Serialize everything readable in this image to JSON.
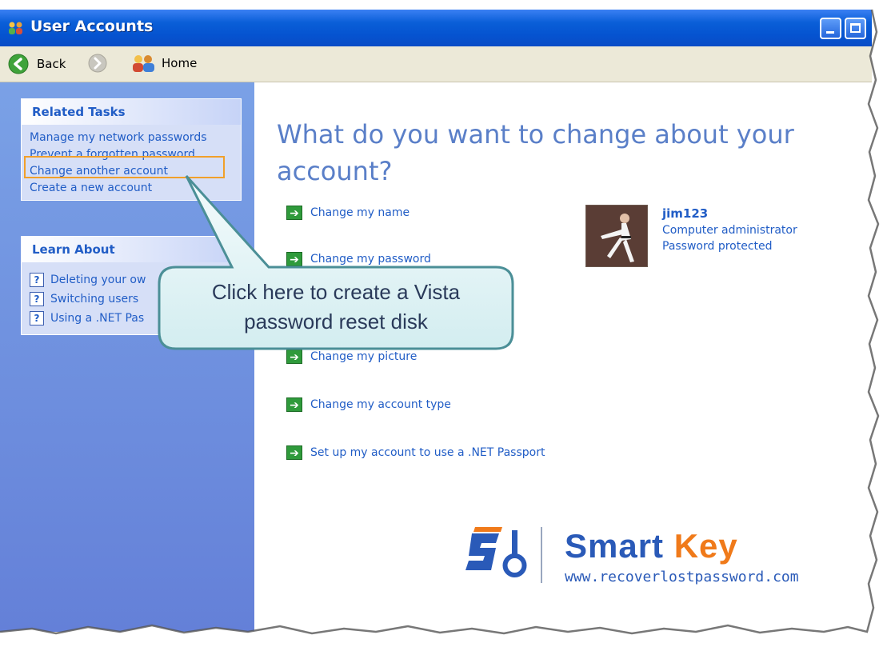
{
  "window": {
    "title": "User Accounts"
  },
  "toolbar": {
    "back_label": "Back",
    "home_label": "Home"
  },
  "sidebar": {
    "related_tasks": {
      "header": "Related Tasks",
      "items": [
        "Manage my network passwords",
        "Prevent a forgotten password",
        "Change another account",
        "Create a new account"
      ]
    },
    "learn_about": {
      "header": "Learn About",
      "items": [
        "Deleting your ow",
        "Switching users",
        "Using a .NET Pas"
      ]
    }
  },
  "main": {
    "heading": "What do you want to change about your account?",
    "tasks": [
      "Change my name",
      "Change my password",
      "Change my picture",
      "Change my account type",
      "Set up my account to use a .NET Passport"
    ]
  },
  "user": {
    "name": "jim123",
    "role": "Computer administrator",
    "status": "Password protected"
  },
  "callout": {
    "line1": "Click here to create a Vista",
    "line2": "password reset disk"
  },
  "watermark": {
    "brand_part1": "Smart ",
    "brand_part2": "Key",
    "url": "www.recoverlostpassword.com"
  },
  "colors": {
    "titlebar": "#0a5fd8",
    "sidebar": "#6d8fdf",
    "link": "#215dc6",
    "heading": "#5a7fc8",
    "highlight": "#f1a02a",
    "logo_orange": "#f07a1a",
    "logo_blue": "#2a5ab8"
  },
  "icons": {
    "back": "back-arrow-icon",
    "forward": "forward-arrow-icon",
    "home": "users-home-icon",
    "help": "help-question-icon",
    "task_arrow": "green-arrow-icon"
  }
}
